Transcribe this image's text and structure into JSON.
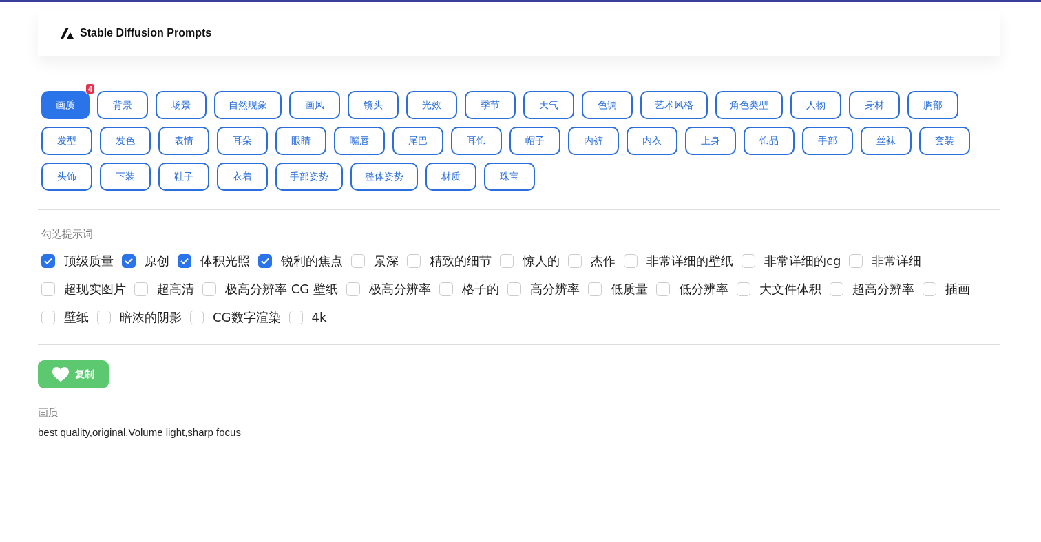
{
  "header": {
    "title": "Stable Diffusion Prompts"
  },
  "categories": [
    {
      "label": "画质",
      "selected": true,
      "badge": "4"
    },
    {
      "label": "背景",
      "selected": false
    },
    {
      "label": "场景",
      "selected": false
    },
    {
      "label": "自然现象",
      "selected": false
    },
    {
      "label": "画风",
      "selected": false
    },
    {
      "label": "镜头",
      "selected": false
    },
    {
      "label": "光效",
      "selected": false
    },
    {
      "label": "季节",
      "selected": false
    },
    {
      "label": "天气",
      "selected": false
    },
    {
      "label": "色调",
      "selected": false
    },
    {
      "label": "艺术风格",
      "selected": false
    },
    {
      "label": "角色类型",
      "selected": false
    },
    {
      "label": "人物",
      "selected": false
    },
    {
      "label": "身材",
      "selected": false
    },
    {
      "label": "胸部",
      "selected": false
    },
    {
      "label": "发型",
      "selected": false
    },
    {
      "label": "发色",
      "selected": false
    },
    {
      "label": "表情",
      "selected": false
    },
    {
      "label": "耳朵",
      "selected": false
    },
    {
      "label": "眼睛",
      "selected": false
    },
    {
      "label": "嘴唇",
      "selected": false
    },
    {
      "label": "尾巴",
      "selected": false
    },
    {
      "label": "耳饰",
      "selected": false
    },
    {
      "label": "帽子",
      "selected": false
    },
    {
      "label": "内裤",
      "selected": false
    },
    {
      "label": "内衣",
      "selected": false
    },
    {
      "label": "上身",
      "selected": false
    },
    {
      "label": "饰品",
      "selected": false
    },
    {
      "label": "手部",
      "selected": false
    },
    {
      "label": "丝袜",
      "selected": false
    },
    {
      "label": "套装",
      "selected": false
    },
    {
      "label": "头饰",
      "selected": false
    },
    {
      "label": "下装",
      "selected": false
    },
    {
      "label": "鞋子",
      "selected": false
    },
    {
      "label": "衣着",
      "selected": false
    },
    {
      "label": "手部姿势",
      "selected": false
    },
    {
      "label": "整体姿势",
      "selected": false
    },
    {
      "label": "材质",
      "selected": false
    },
    {
      "label": "珠宝",
      "selected": false
    }
  ],
  "checklist": {
    "title": "勾选提示词",
    "items": [
      {
        "label": "顶级质量",
        "checked": true
      },
      {
        "label": "原创",
        "checked": true
      },
      {
        "label": "体积光照",
        "checked": true
      },
      {
        "label": "锐利的焦点",
        "checked": true
      },
      {
        "label": "景深",
        "checked": false
      },
      {
        "label": "精致的细节",
        "checked": false
      },
      {
        "label": "惊人的",
        "checked": false
      },
      {
        "label": "杰作",
        "checked": false
      },
      {
        "label": "非常详细的壁纸",
        "checked": false
      },
      {
        "label": "非常详细的cg",
        "checked": false
      },
      {
        "label": "非常详细",
        "checked": false
      },
      {
        "label": "超现实图片",
        "checked": false
      },
      {
        "label": "超高清",
        "checked": false
      },
      {
        "label": "极高分辨率 CG 壁纸",
        "checked": false
      },
      {
        "label": "极高分辨率",
        "checked": false
      },
      {
        "label": "格子的",
        "checked": false
      },
      {
        "label": "高分辨率",
        "checked": false
      },
      {
        "label": "低质量",
        "checked": false
      },
      {
        "label": "低分辨率",
        "checked": false
      },
      {
        "label": "大文件体积",
        "checked": false
      },
      {
        "label": "超高分辨率",
        "checked": false
      },
      {
        "label": "插画",
        "checked": false
      },
      {
        "label": "壁纸",
        "checked": false
      },
      {
        "label": "暗浓的阴影",
        "checked": false
      },
      {
        "label": "CG数字渲染",
        "checked": false
      },
      {
        "label": "4k",
        "checked": false
      }
    ]
  },
  "copy_button": {
    "label": "复制"
  },
  "result": {
    "category": "画质",
    "prompt": "best quality,original,Volume light,sharp focus"
  }
}
